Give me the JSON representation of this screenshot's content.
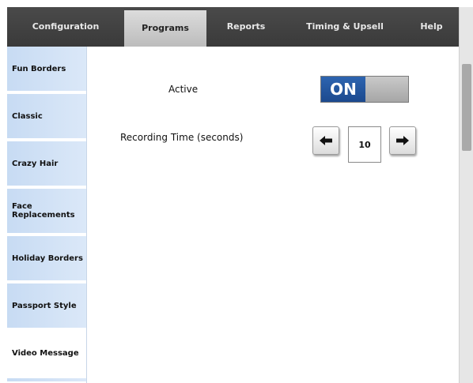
{
  "tabs": [
    {
      "label": "Configuration"
    },
    {
      "label": "Programs"
    },
    {
      "label": "Reports"
    },
    {
      "label": "Timing & Upsell"
    },
    {
      "label": "Help"
    }
  ],
  "active_tab": "Programs",
  "sidebar": {
    "items": [
      {
        "label": "Fun Borders"
      },
      {
        "label": "Classic"
      },
      {
        "label": "Crazy Hair"
      },
      {
        "label": "Face Replacements"
      },
      {
        "label": "Holiday Borders"
      },
      {
        "label": "Passport Style"
      },
      {
        "label": "Video Message"
      }
    ],
    "selected": "Video Message"
  },
  "settings": {
    "active_label": "Active",
    "active_state": "ON",
    "recording_label": "Recording Time (seconds)",
    "recording_value": "10"
  },
  "icons": {
    "decrement": "left-arrow-icon",
    "increment": "right-arrow-icon"
  },
  "colors": {
    "tabbar": "#3f3f3f",
    "toggle_on": "#1f4f96",
    "sidebar_item": "#cfe0f5"
  }
}
